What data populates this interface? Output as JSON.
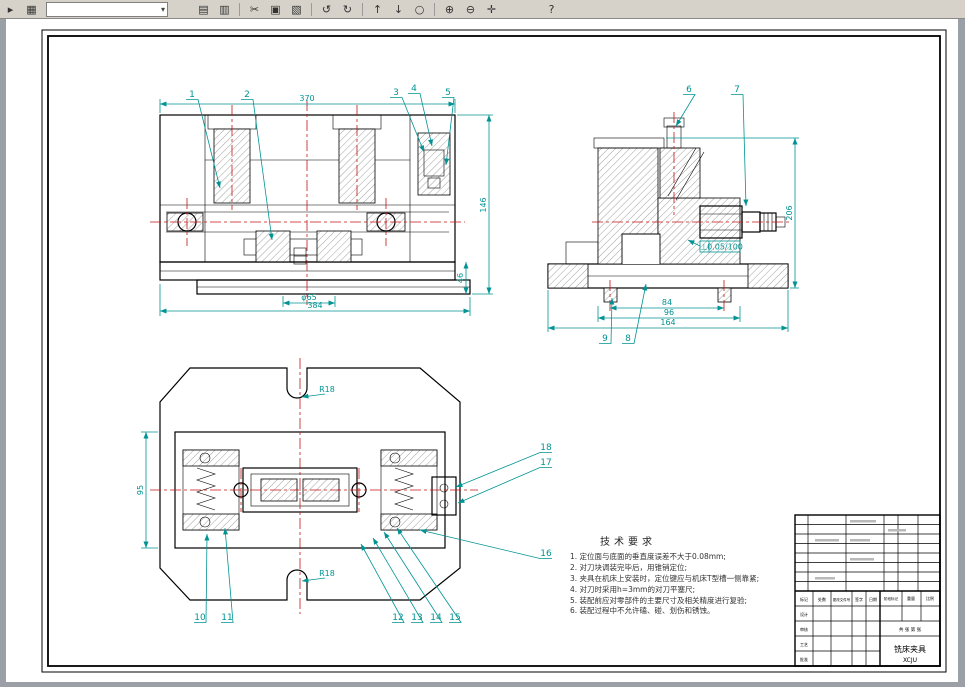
{
  "toolbar": {
    "combo_value": "",
    "combo_caret": "▾",
    "icons": [
      {
        "name": "menu-arrow-icon",
        "glyph": "▸"
      },
      {
        "name": "table-icon",
        "glyph": "▦"
      },
      {
        "name": "print-icon",
        "glyph": "▤"
      },
      {
        "name": "preview-icon",
        "glyph": "▥"
      },
      {
        "name": "cut-icon",
        "glyph": "✂"
      },
      {
        "name": "copy-icon",
        "glyph": "▣"
      },
      {
        "name": "paste-icon",
        "glyph": "▧"
      },
      {
        "name": "undo-icon",
        "glyph": "↺"
      },
      {
        "name": "redo-icon",
        "glyph": "↻"
      },
      {
        "name": "move-up-icon",
        "glyph": "↑"
      },
      {
        "name": "move-down-icon",
        "glyph": "↓"
      },
      {
        "name": "circle-tool-icon",
        "glyph": "○"
      },
      {
        "name": "zoom-in-icon",
        "glyph": "⊕"
      },
      {
        "name": "zoom-out-icon",
        "glyph": "⊖"
      },
      {
        "name": "pan-icon",
        "glyph": "✛"
      },
      {
        "name": "help-icon",
        "glyph": "?"
      }
    ]
  },
  "drawing": {
    "balloons": [
      "1",
      "2",
      "3",
      "4",
      "5",
      "6",
      "7",
      "8",
      "9",
      "10",
      "11",
      "12",
      "13",
      "14",
      "15",
      "16",
      "17",
      "18"
    ],
    "dims": {
      "front_top": "370",
      "front_bottom": "384",
      "front_height": "146",
      "front_step": "46",
      "front_dia": "φ65",
      "side_bottom1": "84",
      "side_bottom2": "96",
      "side_bottom3": "164",
      "side_height": "206",
      "tol_symbol": "⊥",
      "tol_value": "0.05/100",
      "plan_height": "95",
      "plan_radius": "R18"
    },
    "tech": {
      "title": "技术要求",
      "items": [
        "1. 定位面与底面的垂直度误差不大于0.08mm;",
        "2. 对刀块调装完毕后，用锥销定位;",
        "3. 夹具在机床上安装时，定位键应与机床T型槽一侧靠紧;",
        "4. 对刀时采用h=3mm的对刀平塞尺;",
        "5. 装配前应对零部件的主要尺寸及相关精度进行复验;",
        "6. 装配过程中不允许磕、碰、划伤和锈蚀。"
      ]
    },
    "titleblock": {
      "part_name": "铣床夹具",
      "part_code": "XCJU",
      "labels": {
        "mark": "标记",
        "count": "处数",
        "file_no": "更改文件号",
        "sign": "签字",
        "date": "日期",
        "design": "设计",
        "check": "审核",
        "craft": "工艺",
        "approve": "批准",
        "stage": "阶段标记",
        "weight": "重量",
        "scale": "比例",
        "sheets": "共 张 第 张"
      }
    }
  }
}
